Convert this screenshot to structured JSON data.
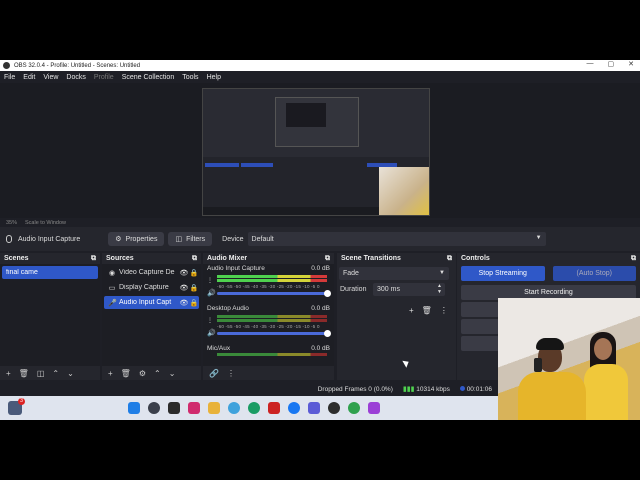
{
  "window": {
    "title": "OBS 32.0.4 - Profile: Untitled - Scenes: Untitled",
    "controls": [
      "—",
      "▢",
      "✕"
    ]
  },
  "menu": {
    "items": [
      {
        "label": "File",
        "disabled": false
      },
      {
        "label": "Edit",
        "disabled": false
      },
      {
        "label": "View",
        "disabled": false
      },
      {
        "label": "Docks",
        "disabled": false
      },
      {
        "label": "Profile",
        "disabled": true
      },
      {
        "label": "Scene Collection",
        "disabled": false
      },
      {
        "label": "Tools",
        "disabled": false
      },
      {
        "label": "Help",
        "disabled": false
      }
    ]
  },
  "preview": {
    "zoom": "35%",
    "scale_label": "Scale to Window"
  },
  "source_toolbar": {
    "source_name": "Audio Input Capture",
    "properties": "Properties",
    "filters": "Filters",
    "device_label": "Device",
    "device_value": "Default"
  },
  "scenes": {
    "title": "Scenes",
    "items": [
      "final came"
    ]
  },
  "sources": {
    "title": "Sources",
    "items": [
      {
        "label": "Video Capture De",
        "icon": "camera-icon",
        "selected": false
      },
      {
        "label": "Display Capture",
        "icon": "monitor-icon",
        "selected": false
      },
      {
        "label": "Audio Input Capt",
        "icon": "mic-icon",
        "selected": true
      }
    ]
  },
  "mixer": {
    "title": "Audio Mixer",
    "scale": "-60 -55 -50 -45 -40 -35 -30 -25 -20 -15 -10 -5 0",
    "channels": [
      {
        "name": "Audio Input Capture",
        "db": "0.0 dB",
        "active": true
      },
      {
        "name": "Desktop Audio",
        "db": "0.0 dB",
        "active": false
      },
      {
        "name": "Mic/Aux",
        "db": "0.0 dB",
        "active": false
      }
    ]
  },
  "transitions": {
    "title": "Scene Transitions",
    "type": "Fade",
    "duration_label": "Duration",
    "duration_value": "300 ms"
  },
  "controls": {
    "title": "Controls",
    "stop_streaming": "Stop Streaming",
    "auto_stop": "(Auto Stop)",
    "start_recording": "Start Recording"
  },
  "status": {
    "dropped_frames": "Dropped Frames 0 (0.0%)",
    "bitrate": "10314 kbps",
    "time": "00:01:06"
  },
  "colors": {
    "accent": "#2f58c8",
    "panel": "#25262d",
    "panel_dark": "#1d1e24"
  }
}
